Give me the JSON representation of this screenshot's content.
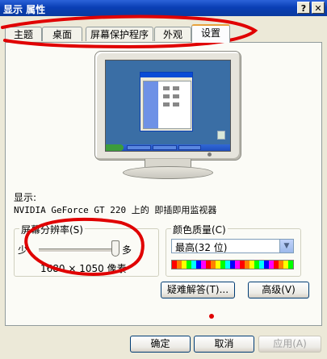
{
  "window": {
    "title": "显示 属性",
    "help_label": "?",
    "close_label": "✕"
  },
  "tabs": [
    {
      "label": "主题",
      "active": false
    },
    {
      "label": "桌面",
      "active": false
    },
    {
      "label": "屏幕保护程序",
      "active": false
    },
    {
      "label": "外观",
      "active": false
    },
    {
      "label": "设置",
      "active": true
    }
  ],
  "display": {
    "label": "显示:",
    "device": "NVIDIA GeForce GT 220 上的 即插即用监视器"
  },
  "resolution": {
    "legend": "屏幕分辨率(S)",
    "min_label": "少",
    "max_label": "多",
    "value": "1680 × 1050 像素",
    "slider_position": 1.0
  },
  "color_quality": {
    "legend": "颜色质量(C)",
    "selected": "最高(32 位)"
  },
  "buttons": {
    "troubleshoot": "疑难解答(T)...",
    "advanced": "高级(V)",
    "ok": "确定",
    "cancel": "取消",
    "apply": "应用(A)"
  },
  "colors": {
    "titlebar": "#0a3fb5",
    "annotation": "#e00000",
    "active_tab_accent": "#e8a23c"
  }
}
